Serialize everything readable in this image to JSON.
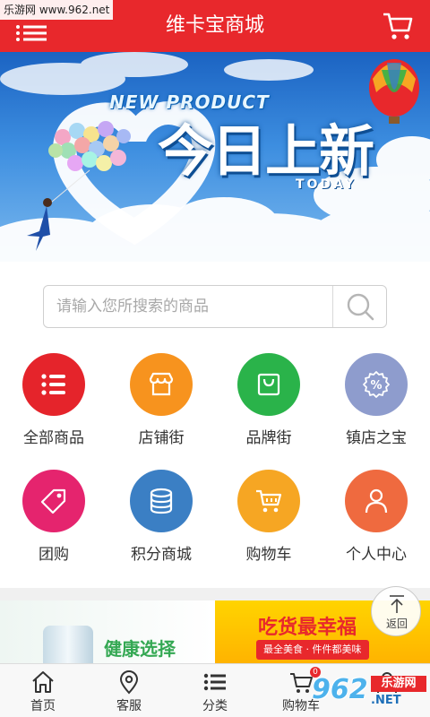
{
  "watermark": {
    "top": "乐游网 www.962.net",
    "num": "962",
    "site": "乐游网",
    "net": ".NET"
  },
  "header": {
    "title": "维卡宝商城"
  },
  "banner": {
    "line1": "NEW PRODUCT",
    "line2": "今日上新",
    "line3": "TODAY"
  },
  "search": {
    "placeholder": "请输入您所搜索的商品"
  },
  "grid": [
    {
      "label": "全部商品",
      "icon": "list-icon",
      "color": "#e5242b"
    },
    {
      "label": "店铺街",
      "icon": "shop-icon",
      "color": "#f7931e"
    },
    {
      "label": "品牌街",
      "icon": "bag-icon",
      "color": "#2ab34a"
    },
    {
      "label": "镇店之宝",
      "icon": "percent-badge-icon",
      "color": "#8e9ccd"
    },
    {
      "label": "团购",
      "icon": "tag-icon",
      "color": "#e5246e"
    },
    {
      "label": "积分商城",
      "icon": "coins-icon",
      "color": "#3b7fc4"
    },
    {
      "label": "购物车",
      "icon": "cart-icon",
      "color": "#f6a623"
    },
    {
      "label": "个人中心",
      "icon": "user-icon",
      "color": "#ef6a3f"
    }
  ],
  "promo": {
    "left_text": "健康选择",
    "right_title": "吃货最幸福",
    "right_sub": "最全美食 · 件件都美味"
  },
  "back_top": {
    "label": "返回"
  },
  "tabbar": [
    {
      "label": "首页",
      "icon": "home-icon"
    },
    {
      "label": "客服",
      "icon": "location-pin-icon"
    },
    {
      "label": "分类",
      "icon": "list-icon"
    },
    {
      "label": "购物车",
      "icon": "cart-icon",
      "badge": "0"
    },
    {
      "label": "",
      "icon": "user-icon"
    }
  ]
}
